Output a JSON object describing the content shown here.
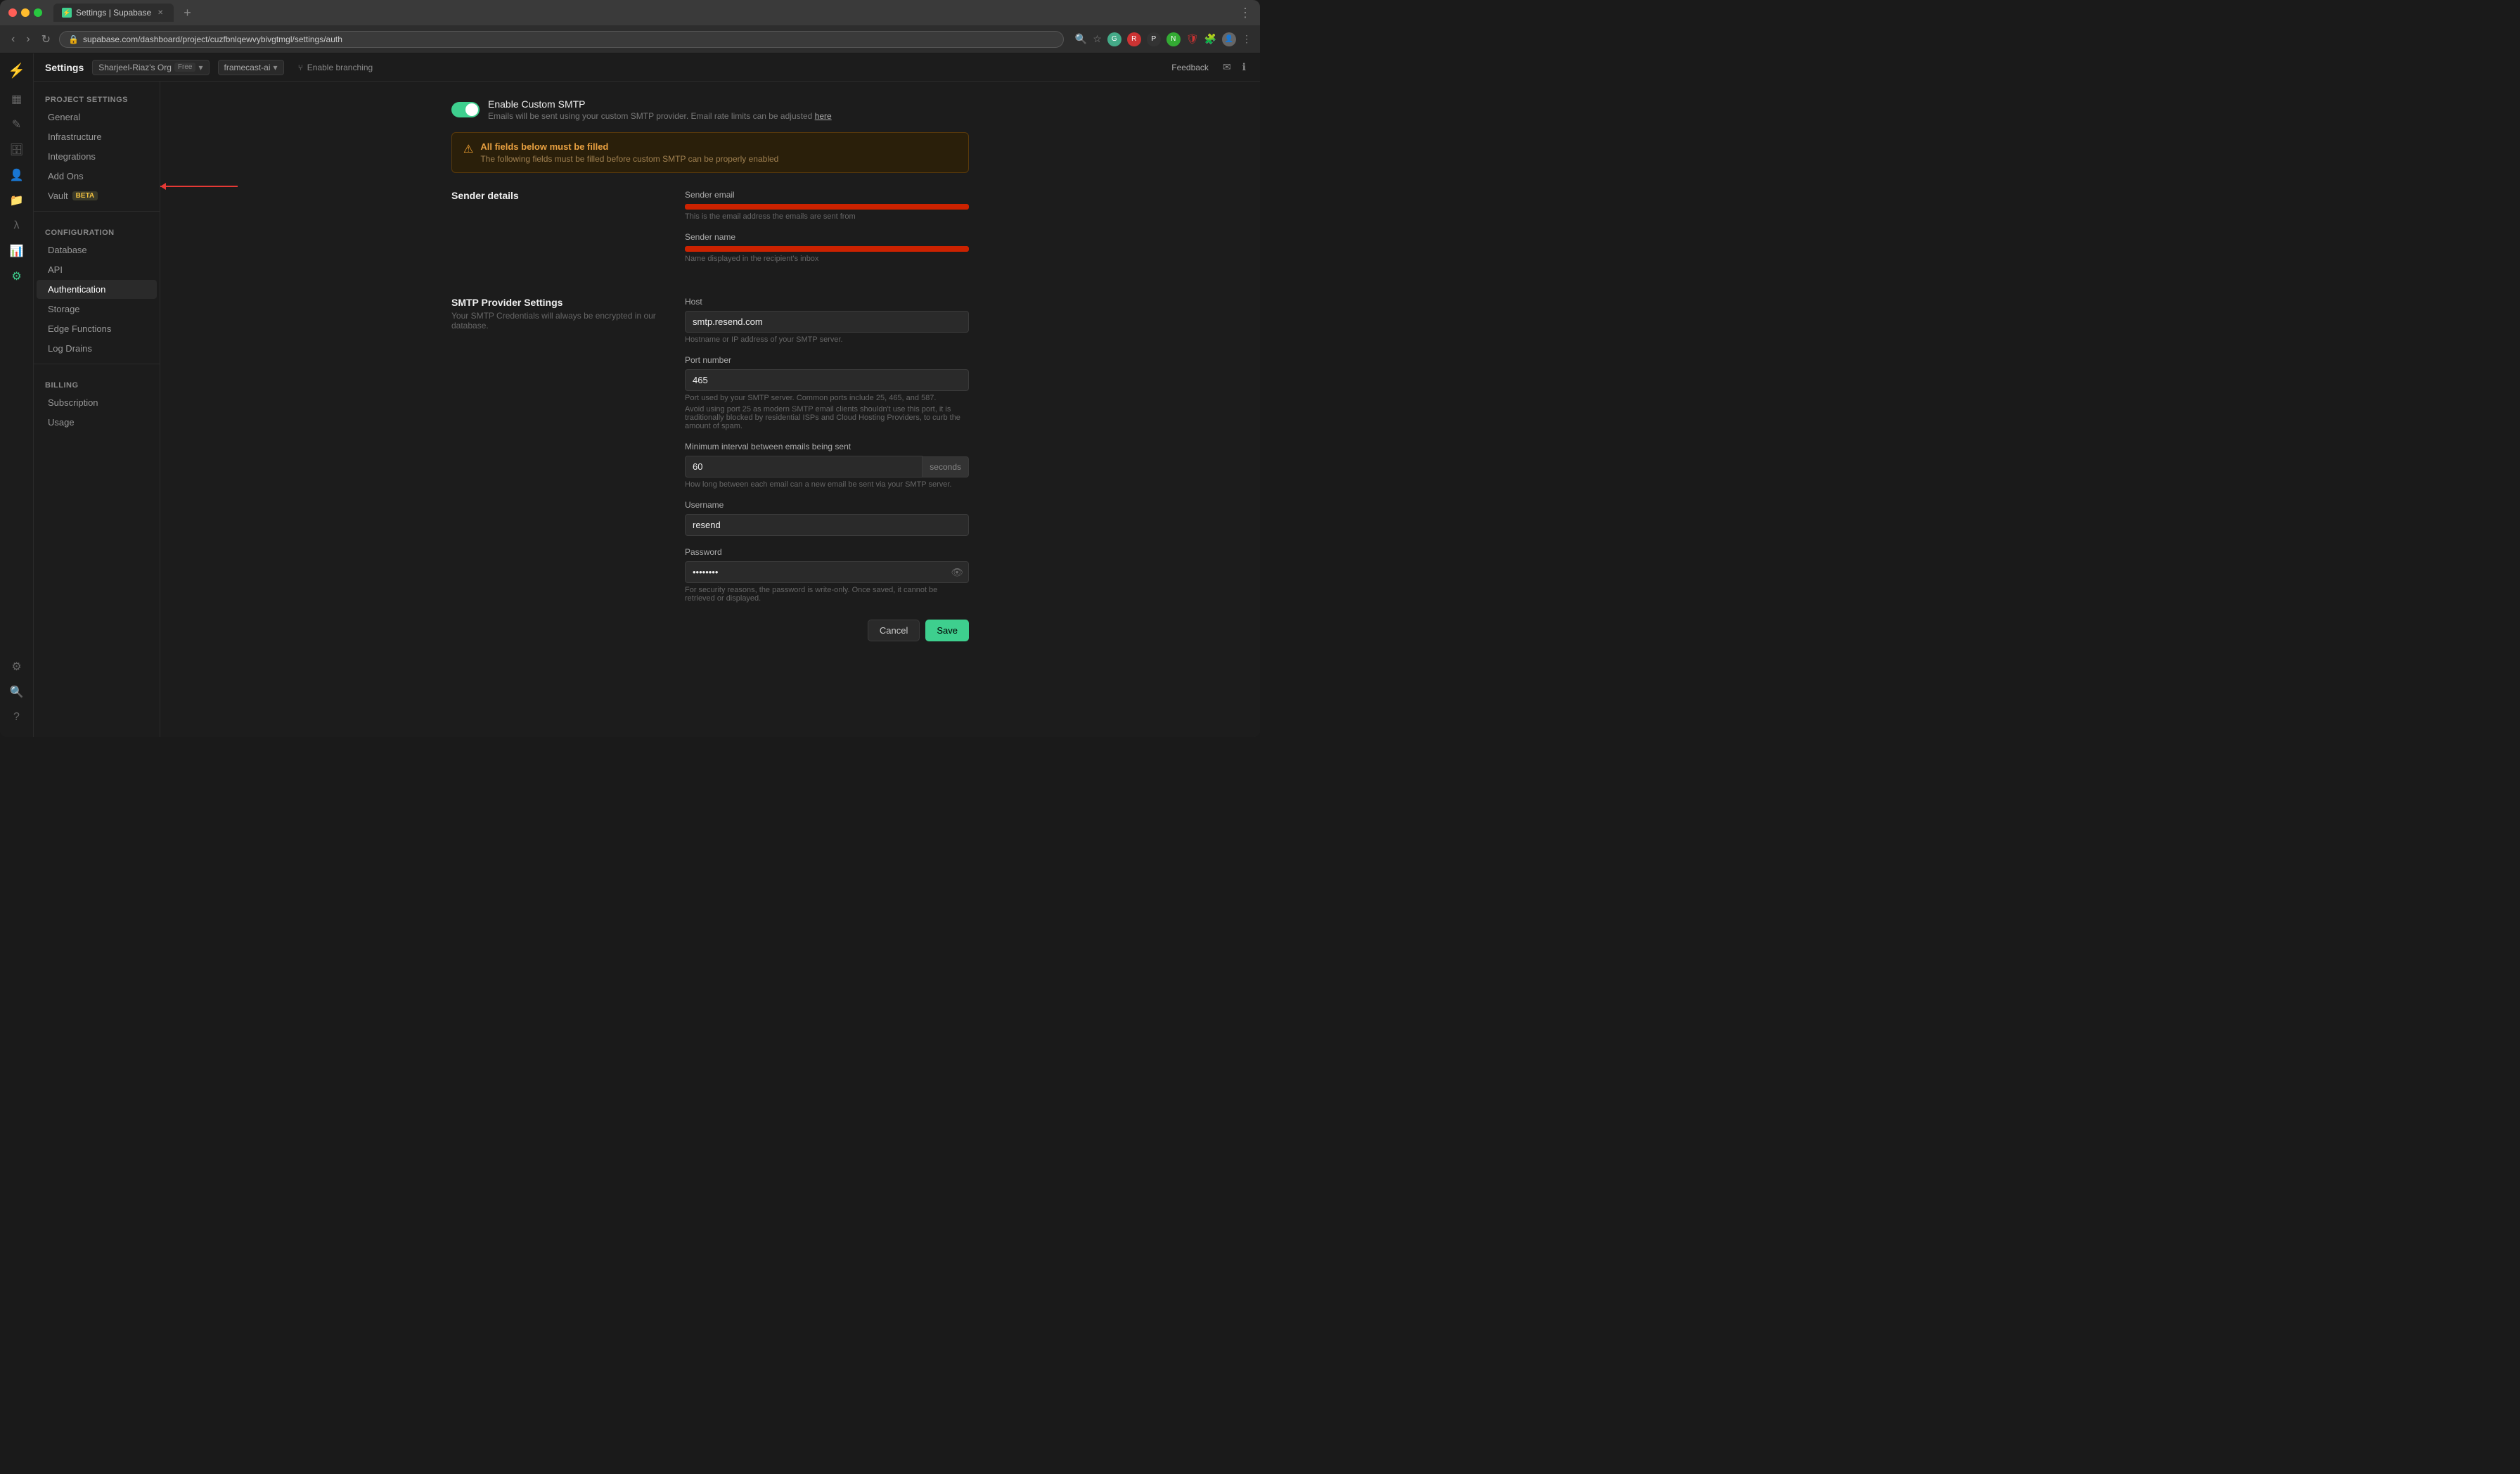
{
  "browser": {
    "tab_title": "Settings | Supabase",
    "url": "supabase.com/dashboard/project/cuzfbnlqewvybivgtmgl/settings/auth",
    "new_tab_label": "+"
  },
  "topbar": {
    "settings_label": "Settings",
    "org_name": "Sharjeel-Riaz's Org",
    "plan_label": "Free",
    "project_name": "framecast-ai",
    "enable_branching_label": "Enable branching",
    "feedback_label": "Feedback"
  },
  "sidebar": {
    "project_settings_header": "PROJECT SETTINGS",
    "items_project": [
      {
        "label": "General",
        "id": "general"
      },
      {
        "label": "Infrastructure",
        "id": "infrastructure"
      },
      {
        "label": "Integrations",
        "id": "integrations"
      },
      {
        "label": "Add Ons",
        "id": "add-ons"
      },
      {
        "label": "Vault",
        "id": "vault",
        "badge": "BETA"
      }
    ],
    "configuration_header": "CONFIGURATION",
    "items_config": [
      {
        "label": "Database",
        "id": "database"
      },
      {
        "label": "API",
        "id": "api"
      },
      {
        "label": "Authentication",
        "id": "authentication",
        "active": true
      },
      {
        "label": "Storage",
        "id": "storage"
      },
      {
        "label": "Edge Functions",
        "id": "edge-functions"
      },
      {
        "label": "Log Drains",
        "id": "log-drains"
      }
    ],
    "billing_header": "BILLING",
    "items_billing": [
      {
        "label": "Subscription",
        "id": "subscription"
      },
      {
        "label": "Usage",
        "id": "usage"
      }
    ]
  },
  "smtp": {
    "toggle_label": "Enable Custom SMTP",
    "toggle_hint": "Emails will be sent using your custom SMTP provider. Email rate limits can be adjusted",
    "toggle_hint_link": "here",
    "warning_title": "All fields below must be filled",
    "warning_text": "The following fields must be filled before custom SMTP can be properly enabled",
    "sender_details_title": "Sender details",
    "sender_email_label": "Sender email",
    "sender_email_hint": "This is the email address the emails are sent from",
    "sender_email_value": "",
    "sender_name_label": "Sender name",
    "sender_name_hint": "Name displayed in the recipient's inbox",
    "sender_name_value": "",
    "smtp_provider_title": "SMTP Provider Settings",
    "smtp_provider_desc": "Your SMTP Credentials will always be encrypted in our database.",
    "host_label": "Host",
    "host_value": "smtp.resend.com",
    "host_placeholder": "smtp.resend.com",
    "host_hint": "Hostname or IP address of your SMTP server.",
    "port_label": "Port number",
    "port_value": "465",
    "port_hint1": "Port used by your SMTP server. Common ports include 25, 465, and 587.",
    "port_hint2": "Avoid using port 25 as modern SMTP email clients shouldn't use this port, it is traditionally blocked by residential ISPs and Cloud Hosting Providers, to curb the amount of spam.",
    "min_interval_label": "Minimum interval between emails being sent",
    "min_interval_value": "60",
    "min_interval_suffix": "seconds",
    "min_interval_hint": "How long between each email can a new email be sent via your SMTP server.",
    "username_label": "Username",
    "username_value": "resend",
    "password_label": "Password",
    "password_value": "••••••••",
    "password_hint": "For security reasons, the password is write-only. Once saved, it cannot be retrieved or displayed.",
    "cancel_label": "Cancel",
    "save_label": "Save"
  }
}
